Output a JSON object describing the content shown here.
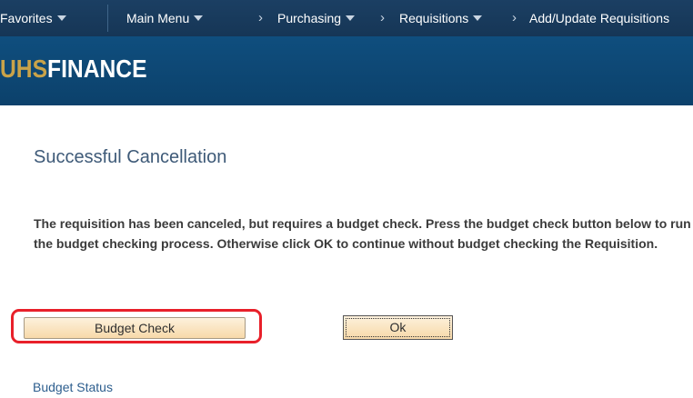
{
  "nav": {
    "favorites": "Favorites",
    "main_menu": "Main Menu",
    "breadcrumbs": [
      "Purchasing",
      "Requisitions",
      "Add/Update Requisitions"
    ],
    "separator": "›"
  },
  "banner": {
    "logo_part1": "UHS",
    "logo_part2": "FINANCE"
  },
  "page": {
    "title": "Successful Cancellation",
    "message": "The requisition has been canceled, but requires a budget check. Press the budget check button below to run the budget checking process. Otherwise click OK to continue without budget checking the Requisition."
  },
  "buttons": {
    "budget_check": "Budget Check",
    "ok": "Ok"
  },
  "links": {
    "budget_status": "Budget Status"
  },
  "colors": {
    "nav_bg": "#1b3f63",
    "banner_bg": "#0f4e7e",
    "logo_gold": "#c9a349",
    "highlight_red": "#e8202a",
    "button_bg": "#f7d9a9"
  }
}
